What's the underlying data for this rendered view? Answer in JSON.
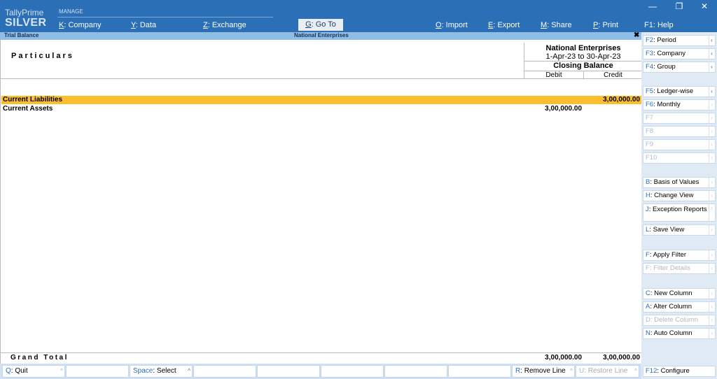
{
  "app": {
    "brand_line1": "TallyPrime",
    "brand_line2": "SILVER"
  },
  "topmenu": {
    "section": "MANAGE",
    "items": [
      {
        "key": "K",
        "label": ": Company"
      },
      {
        "key": "Y",
        "label": ": Data"
      },
      {
        "key": "Z",
        "label": ": Exchange"
      },
      {
        "key": "G",
        "label": ": Go To"
      },
      {
        "key": "O",
        "label": ": Import"
      },
      {
        "key": "E",
        "label": ": Export"
      },
      {
        "key": "M",
        "label": ": Share"
      },
      {
        "key": "P",
        "label": ": Print"
      }
    ],
    "help": "F1: Help"
  },
  "window_controls": {
    "minimize": "—",
    "restore": "❐",
    "close": "✕"
  },
  "titlebar": {
    "left": "Trial Balance",
    "center": "National Enterprises",
    "close": "✖"
  },
  "report": {
    "particulars_label": "Particulars",
    "company": "National Enterprises",
    "period": "1-Apr-23 to 30-Apr-23",
    "column_group": "Closing Balance",
    "debit_label": "Debit",
    "credit_label": "Credit",
    "rows": [
      {
        "name": "Current Liabilities",
        "debit": "",
        "credit": "3,00,000.00"
      },
      {
        "name": "Current Assets",
        "debit": "3,00,000.00",
        "credit": ""
      }
    ],
    "grand_total": {
      "label": "Grand Total",
      "debit": "3,00,000.00",
      "credit": "3,00,000.00"
    }
  },
  "bottombar": [
    {
      "key": "Q",
      "label": ": Quit"
    },
    {
      "key": "",
      "label": ""
    },
    {
      "key": "Space",
      "label": ": Select"
    },
    {
      "key": "",
      "label": ""
    },
    {
      "key": "",
      "label": ""
    },
    {
      "key": "",
      "label": ""
    },
    {
      "key": "",
      "label": ""
    },
    {
      "key": "",
      "label": ""
    },
    {
      "key": "R",
      "label": ": Remove Line"
    },
    {
      "key": "U",
      "label": ": Restore Line"
    }
  ],
  "sidebar": {
    "items": [
      {
        "key": "F2",
        "label": ": Period"
      },
      {
        "key": "F3",
        "label": ": Company"
      },
      {
        "key": "F4",
        "label": ": Group"
      },
      {
        "key": "F5",
        "label": ": Ledger-wise"
      },
      {
        "key": "F6",
        "label": ": Monthly"
      },
      {
        "key": "F7",
        "label": ""
      },
      {
        "key": "F8",
        "label": ""
      },
      {
        "key": "F9",
        "label": ""
      },
      {
        "key": "F10",
        "label": ""
      },
      {
        "key": "B",
        "label": ": Basis of Values"
      },
      {
        "key": "H",
        "label": ": Change View"
      },
      {
        "key": "J",
        "label": ": Exception Reports"
      },
      {
        "key": "L",
        "label": ": Save View"
      },
      {
        "key": "F",
        "label": ": Apply Filter"
      },
      {
        "key": "F",
        "label": ": Filter Details"
      },
      {
        "key": "C",
        "label": ": New Column"
      },
      {
        "key": "A",
        "label": ": Alter Column"
      },
      {
        "key": "D",
        "label": ": Delete Column"
      },
      {
        "key": "N",
        "label": ": Auto Column"
      },
      {
        "key": "F12",
        "label": ": Configure"
      }
    ]
  },
  "colors": {
    "header_blue": "#2b6fb6",
    "highlight_row": "#fbbf2e",
    "title_strip": "#8fbde6"
  }
}
